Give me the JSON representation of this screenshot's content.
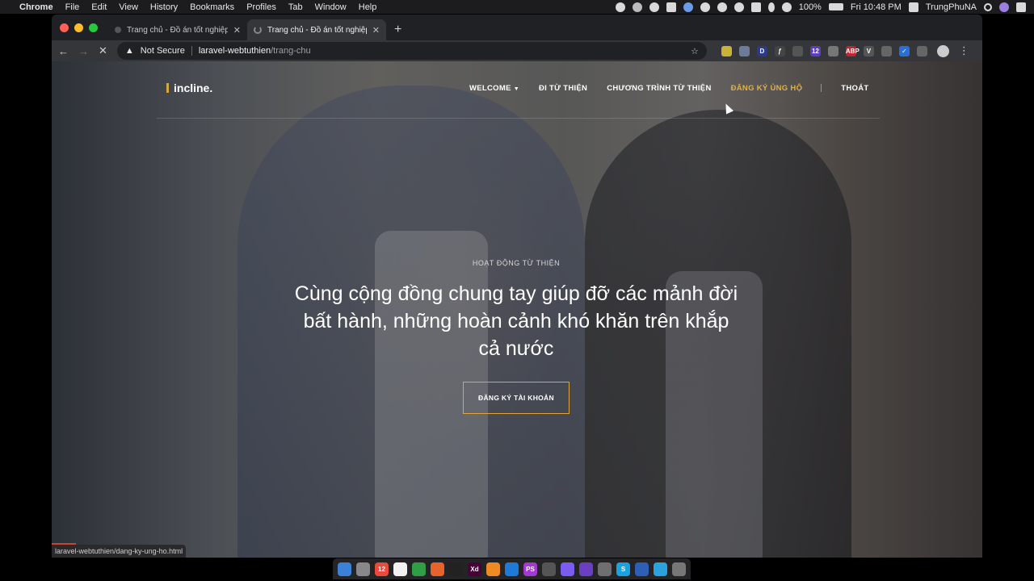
{
  "menubar": {
    "app": "Chrome",
    "items": [
      "File",
      "Edit",
      "View",
      "History",
      "Bookmarks",
      "Profiles",
      "Tab",
      "Window",
      "Help"
    ],
    "battery": "100%",
    "clock": "Fri 10:48 PM",
    "user": "TrungPhuNA"
  },
  "tabs": [
    {
      "title": "Trang chủ - Đồ án tốt nghiệp",
      "close": "✕"
    },
    {
      "title": "Trang chủ - Đồ án tốt nghiệp",
      "close": "✕"
    }
  ],
  "new_tab": "+",
  "address": {
    "security": "Not Secure",
    "host": "laravel-webtuthien",
    "path": "/trang-chu"
  },
  "extensions": [
    {
      "name": "pin-icon",
      "label": "",
      "color": "#c9b23a"
    },
    {
      "name": "circle-ext-icon",
      "label": "",
      "color": "#6b7b99"
    },
    {
      "name": "d-ext-icon",
      "label": "D",
      "color": "#2c3a8c"
    },
    {
      "name": "script-ext-icon",
      "label": "ƒ",
      "color": "#444"
    },
    {
      "name": "gray-ext-icon",
      "label": "",
      "color": "#555"
    },
    {
      "name": "badge-ext-icon",
      "label": "12",
      "color": "#5b3fbf"
    },
    {
      "name": "camera-ext-icon",
      "label": "",
      "color": "#777"
    },
    {
      "name": "abp-icon",
      "label": "ABP",
      "color": "#c0262d"
    },
    {
      "name": "vue-ext-icon",
      "label": "V",
      "color": "#555"
    },
    {
      "name": "translate-ext-icon",
      "label": "",
      "color": "#666"
    },
    {
      "name": "check-ext-icon",
      "label": "✓",
      "color": "#2a6fd6"
    },
    {
      "name": "puzzle-icon",
      "label": "",
      "color": "#666"
    }
  ],
  "site": {
    "logo": "incline.",
    "nav": {
      "welcome": "WELCOME",
      "di_tu_thien": "ĐI TỪ THIỆN",
      "chuong_trinh": "CHƯƠNG TRÌNH TỪ THIỆN",
      "dang_ky_ung_ho": "ĐĂNG KÝ ỦNG HỘ",
      "thoat": "THOÁT"
    },
    "hero": {
      "eyebrow": "HOẠT ĐỘNG TỪ THIỆN",
      "headline": "Cùng cộng đồng chung tay giúp đỡ các mảnh đời bất hành, những hoàn cảnh khó khăn trên khắp cả nước",
      "cta": "ĐĂNG KÝ TÀI KHOẢN"
    },
    "accent_color": "#d8a83c"
  },
  "status_url": "laravel-webtuthien/dang-ky-ung-ho.html",
  "dock": [
    {
      "name": "finder-icon",
      "color": "#3b82d6"
    },
    {
      "name": "launchpad-icon",
      "color": "#888"
    },
    {
      "name": "calendar-icon",
      "color": "#e84c3d",
      "label": "12"
    },
    {
      "name": "notes-icon",
      "color": "#f2f2f2"
    },
    {
      "name": "chrome-icon",
      "color": "#2f9e44"
    },
    {
      "name": "firefox-icon",
      "color": "#e8622b"
    },
    {
      "name": "terminal-icon",
      "color": "#222"
    },
    {
      "name": "xd-icon",
      "color": "#470137",
      "label": "Xd"
    },
    {
      "name": "sublime-icon",
      "color": "#f08a24"
    },
    {
      "name": "vscode-icon",
      "color": "#1e7ad6"
    },
    {
      "name": "phpstorm-icon",
      "color": "#a23ad1",
      "label": "PS"
    },
    {
      "name": "alfred-icon",
      "color": "#555"
    },
    {
      "name": "messenger-icon",
      "color": "#7b5cf0"
    },
    {
      "name": "visual-studio-icon",
      "color": "#6a3fc1"
    },
    {
      "name": "github-desktop-icon",
      "color": "#6f6f6f"
    },
    {
      "name": "skype-icon",
      "color": "#1ba0e0",
      "label": "S"
    },
    {
      "name": "sourcetree-icon",
      "color": "#2c5fb5"
    },
    {
      "name": "telegram-icon",
      "color": "#2aa3dc"
    },
    {
      "name": "trash-icon",
      "color": "#777"
    }
  ]
}
